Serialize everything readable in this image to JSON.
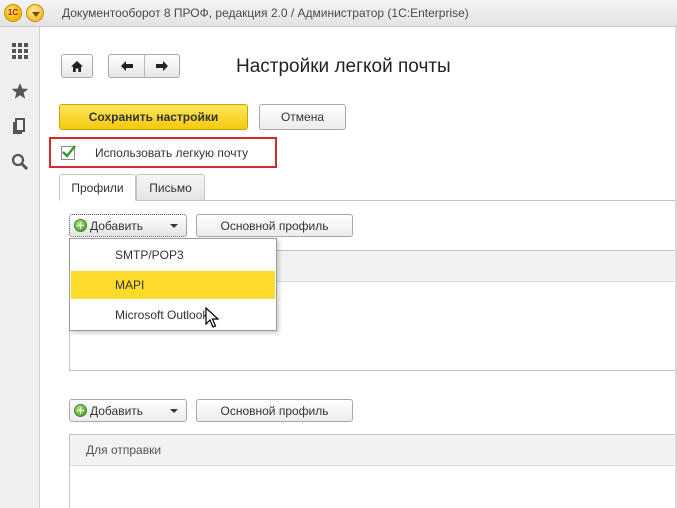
{
  "window": {
    "title": "Документооборот 8 ПРОФ, редакция 2.0 / Администратор  (1С:Enterprise)",
    "logo_text": "1C"
  },
  "sidebar": {
    "icons": [
      "apps-grid-icon",
      "star-icon",
      "history-icon",
      "search-icon"
    ]
  },
  "page": {
    "title": "Настройки легкой почты"
  },
  "toolbar": {
    "save_label": "Сохранить настройки",
    "cancel_label": "Отмена"
  },
  "use_easy_mail": {
    "label": "Использовать легкую почту",
    "checked": true
  },
  "tabs": [
    {
      "label": "Профили",
      "active": true
    },
    {
      "label": "Письмо",
      "active": false
    }
  ],
  "profiles_section": {
    "add_label": "Добавить",
    "main_profile_label": "Основной профиль",
    "dropdown_items": [
      {
        "label": "SMTP/POP3",
        "selected": false
      },
      {
        "label": "MAPI",
        "selected": true
      },
      {
        "label": "Microsoft Outlook",
        "selected": false
      }
    ]
  },
  "sending_section": {
    "add_label": "Добавить",
    "main_profile_label": "Основной профиль",
    "table_header": "Для отправки"
  },
  "colors": {
    "accent_yellow": "#fcdb2b",
    "highlight_border": "#d62a2a",
    "check_green": "#2e9b2e"
  }
}
